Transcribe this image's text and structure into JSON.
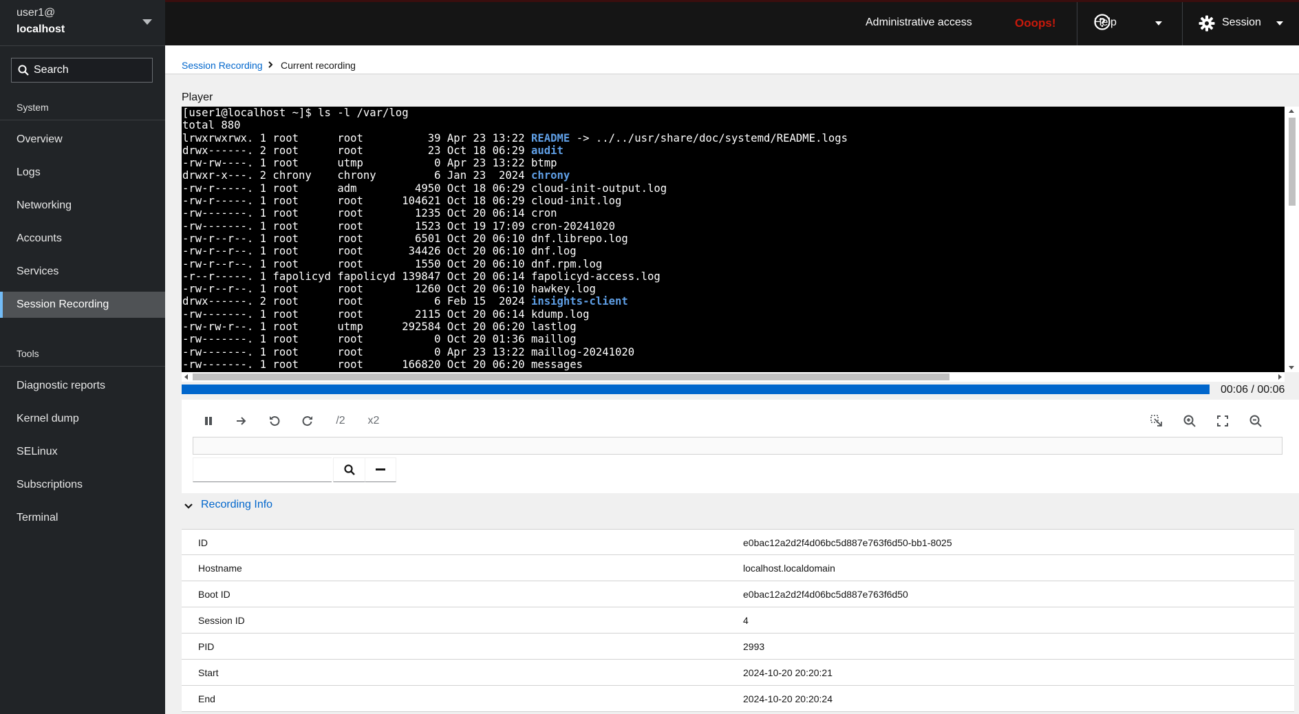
{
  "host": {
    "user": "user1@",
    "name": "localhost"
  },
  "sidebar": {
    "search_placeholder": "Search",
    "system_title": "System",
    "system_items": [
      "Overview",
      "Logs",
      "Networking",
      "Accounts",
      "Services",
      "Session Recording"
    ],
    "tools_title": "Tools",
    "tools_items": [
      "Diagnostic reports",
      "Kernel dump",
      "SELinux",
      "Subscriptions",
      "Terminal"
    ]
  },
  "topbar": {
    "admin_access": "Administrative access",
    "ooops": "Ooops!",
    "help_label": "Help",
    "session_label": "Session"
  },
  "breadcrumb": {
    "link": "Session Recording",
    "current": "Current recording"
  },
  "player": {
    "title": "Player",
    "time": "00:06 / 00:06",
    "progress": 1.0,
    "speed_down": "/2",
    "speed_up": "x2",
    "terminal_lines": [
      {
        "text": "[user1@localhost ~]$ ls -l /var/log",
        "dir": ""
      },
      {
        "text": "total 880",
        "dir": ""
      },
      {
        "text": "lrwxrwxrwx. 1 root      root          39 Apr 23 13:22 ",
        "dir": "README",
        "after": " -> ../../usr/share/doc/systemd/README.logs"
      },
      {
        "text": "drwx------. 2 root      root          23 Oct 18 06:29 ",
        "dir": "audit"
      },
      {
        "text": "-rw-rw----. 1 root      utmp           0 Apr 23 13:22 btmp",
        "dir": ""
      },
      {
        "text": "drwxr-x---. 2 chrony    chrony         6 Jan 23  2024 ",
        "dir": "chrony"
      },
      {
        "text": "-rw-r-----. 1 root      adm         4950 Oct 18 06:29 cloud-init-output.log",
        "dir": ""
      },
      {
        "text": "-rw-r-----. 1 root      root      104621 Oct 18 06:29 cloud-init.log",
        "dir": ""
      },
      {
        "text": "-rw-------. 1 root      root        1235 Oct 20 06:14 cron",
        "dir": ""
      },
      {
        "text": "-rw-------. 1 root      root        1523 Oct 19 17:09 cron-20241020",
        "dir": ""
      },
      {
        "text": "-rw-r--r--. 1 root      root        6501 Oct 20 06:10 dnf.librepo.log",
        "dir": ""
      },
      {
        "text": "-rw-r--r--. 1 root      root       34426 Oct 20 06:10 dnf.log",
        "dir": ""
      },
      {
        "text": "-rw-r--r--. 1 root      root        1550 Oct 20 06:10 dnf.rpm.log",
        "dir": ""
      },
      {
        "text": "-r--r-----. 1 fapolicyd fapolicyd 139847 Oct 20 06:14 fapolicyd-access.log",
        "dir": ""
      },
      {
        "text": "-rw-r--r--. 1 root      root        1260 Oct 20 06:10 hawkey.log",
        "dir": ""
      },
      {
        "text": "drwx------. 2 root      root           6 Feb 15  2024 ",
        "dir": "insights-client"
      },
      {
        "text": "-rw-------. 1 root      root        2115 Oct 20 06:14 kdump.log",
        "dir": ""
      },
      {
        "text": "-rw-rw-r--. 1 root      utmp      292584 Oct 20 06:20 lastlog",
        "dir": ""
      },
      {
        "text": "-rw-------. 1 root      root           0 Oct 20 01:36 maillog",
        "dir": ""
      },
      {
        "text": "-rw-------. 1 root      root           0 Apr 23 13:22 maillog-20241020",
        "dir": ""
      },
      {
        "text": "-rw-------. 1 root      root      166820 Oct 20 06:20 messages",
        "dir": ""
      }
    ]
  },
  "recording_info": {
    "toggle_label": "Recording Info",
    "rows": [
      {
        "key": "ID",
        "value": "e0bac12a2d2f4d06bc5d887e763f6d50-bb1-8025"
      },
      {
        "key": "Hostname",
        "value": "localhost.localdomain"
      },
      {
        "key": "Boot ID",
        "value": "e0bac12a2d2f4d06bc5d887e763f6d50"
      },
      {
        "key": "Session ID",
        "value": "4"
      },
      {
        "key": "PID",
        "value": "2993"
      },
      {
        "key": "Start",
        "value": "2024-10-20 20:20:21"
      },
      {
        "key": "End",
        "value": "2024-10-20 20:20:24"
      }
    ]
  },
  "colors": {
    "accent": "#0066cc",
    "sidebar_bg": "#212427",
    "topbar_bg": "#151515",
    "error": "#c9190b",
    "active_border": "#73bcf7"
  }
}
